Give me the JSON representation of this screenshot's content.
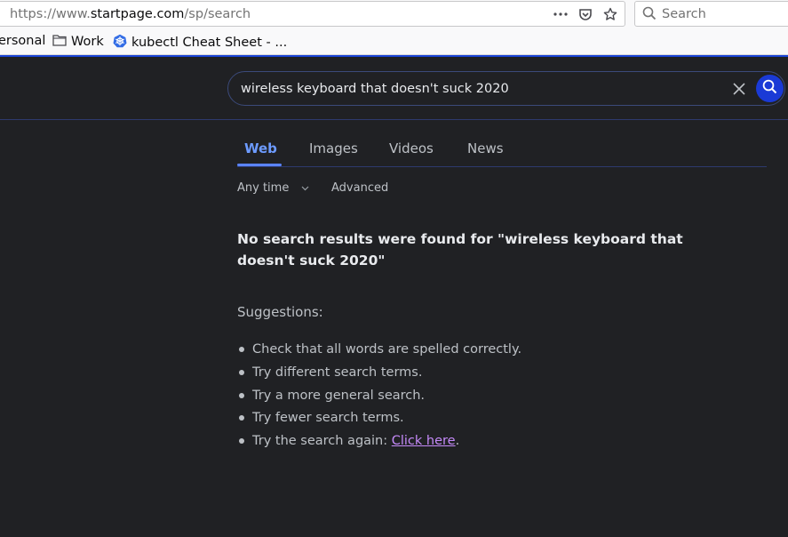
{
  "browser": {
    "url_prefix": "https://www.",
    "url_domain": "startpage.com",
    "url_path": "/sp/search",
    "search_placeholder": "Search",
    "bookmarks": [
      {
        "label": "ersonal",
        "icon": "none"
      },
      {
        "label": "Work",
        "icon": "folder-icon"
      },
      {
        "label": "kubectl Cheat Sheet - ...",
        "icon": "kubernetes-icon"
      }
    ]
  },
  "search": {
    "query": "wireless keyboard that doesn't suck 2020"
  },
  "tabs": [
    {
      "label": "Web",
      "active": true
    },
    {
      "label": "Images",
      "active": false
    },
    {
      "label": "Videos",
      "active": false
    },
    {
      "label": "News",
      "active": false
    }
  ],
  "filters": {
    "time_label": "Any time",
    "advanced_label": "Advanced"
  },
  "results": {
    "no_results_message": "No search results were found for \"wireless keyboard that doesn't suck 2020\"",
    "suggestions_heading": "Suggestions:",
    "suggestions": [
      "Check that all words are spelled correctly.",
      "Try different search terms.",
      "Try a more general search.",
      "Try fewer search terms."
    ],
    "retry_prefix": "Try the search again: ",
    "retry_link": "Click here",
    "retry_suffix": "."
  },
  "colors": {
    "page_bg": "#202124",
    "accent": "#1a3ad6",
    "active_tab": "#6d9bff",
    "link": "#c58af9"
  }
}
